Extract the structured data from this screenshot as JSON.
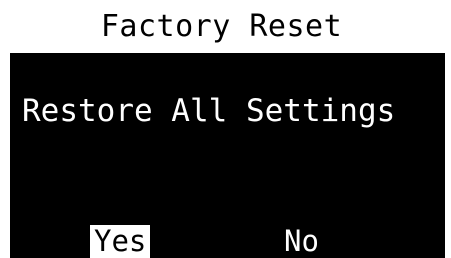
{
  "title": "Factory Reset",
  "message": "Restore All Settings",
  "options": {
    "yes": "Yes",
    "no": "No"
  },
  "selected_option": "Yes",
  "colors": {
    "background": "#000000",
    "foreground": "#ffffff"
  }
}
